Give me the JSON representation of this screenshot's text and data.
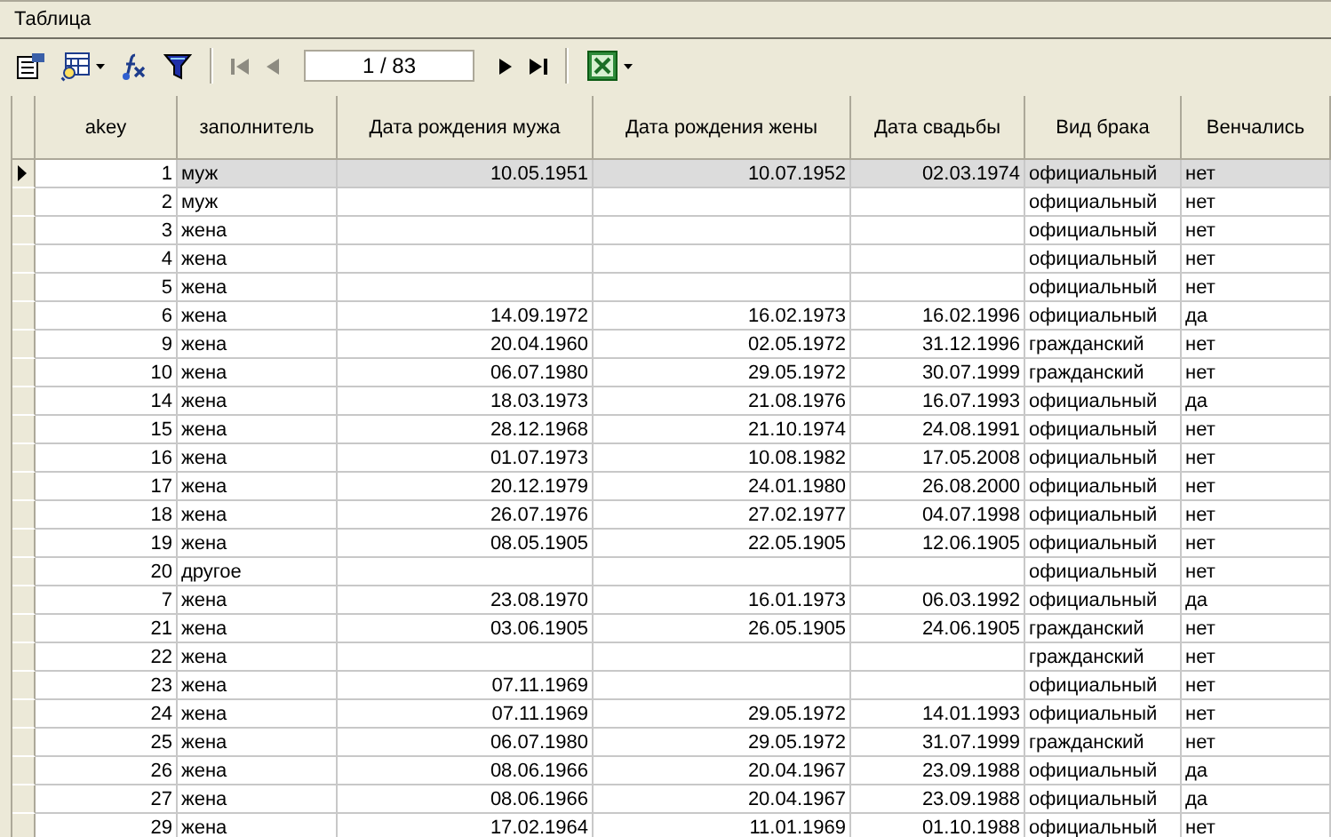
{
  "window": {
    "title": "Таблица"
  },
  "toolbar": [
    {
      "kind": "properties",
      "disabled": false,
      "dropdown": false
    },
    {
      "kind": "grid-search",
      "disabled": false,
      "dropdown": true
    },
    {
      "kind": "formula",
      "disabled": false,
      "dropdown": false
    },
    {
      "kind": "filter",
      "disabled": false,
      "dropdown": false
    },
    {
      "kind": "separator"
    },
    {
      "kind": "first",
      "disabled": true,
      "dropdown": false
    },
    {
      "kind": "prev",
      "disabled": true,
      "dropdown": false
    },
    {
      "kind": "page",
      "value": "1 / 83"
    },
    {
      "kind": "next",
      "disabled": false,
      "dropdown": false
    },
    {
      "kind": "last",
      "disabled": false,
      "dropdown": false
    },
    {
      "kind": "separator"
    },
    {
      "kind": "excel",
      "disabled": false,
      "dropdown": true
    }
  ],
  "table": {
    "columns": [
      "akey",
      "заполнитель",
      "Дата рождения мужа",
      "Дата рождения жены",
      "Дата свадьбы",
      "Вид брака",
      "Венчались"
    ],
    "rows": [
      {
        "selected": true,
        "cells": [
          "1",
          "муж",
          "10.05.1951",
          "10.07.1952",
          "02.03.1974",
          "официальный",
          "нет"
        ]
      },
      {
        "selected": false,
        "cells": [
          "2",
          "муж",
          null,
          null,
          null,
          "официальный",
          "нет"
        ]
      },
      {
        "selected": false,
        "cells": [
          "3",
          "жена",
          null,
          null,
          null,
          "официальный",
          "нет"
        ]
      },
      {
        "selected": false,
        "cells": [
          "4",
          "жена",
          null,
          null,
          null,
          "официальный",
          "нет"
        ]
      },
      {
        "selected": false,
        "cells": [
          "5",
          "жена",
          null,
          null,
          null,
          "официальный",
          "нет"
        ]
      },
      {
        "selected": false,
        "cells": [
          "6",
          "жена",
          "14.09.1972",
          "16.02.1973",
          "16.02.1996",
          "официальный",
          "да"
        ]
      },
      {
        "selected": false,
        "cells": [
          "9",
          "жена",
          "20.04.1960",
          "02.05.1972",
          "31.12.1996",
          "гражданский",
          "нет"
        ]
      },
      {
        "selected": false,
        "cells": [
          "10",
          "жена",
          "06.07.1980",
          "29.05.1972",
          "30.07.1999",
          "гражданский",
          "нет"
        ]
      },
      {
        "selected": false,
        "cells": [
          "14",
          "жена",
          "18.03.1973",
          "21.08.1976",
          "16.07.1993",
          "официальный",
          "да"
        ]
      },
      {
        "selected": false,
        "cells": [
          "15",
          "жена",
          "28.12.1968",
          "21.10.1974",
          "24.08.1991",
          "официальный",
          "нет"
        ]
      },
      {
        "selected": false,
        "cells": [
          "16",
          "жена",
          "01.07.1973",
          "10.08.1982",
          "17.05.2008",
          "официальный",
          "нет"
        ]
      },
      {
        "selected": false,
        "cells": [
          "17",
          "жена",
          "20.12.1979",
          "24.01.1980",
          "26.08.2000",
          "официальный",
          "нет"
        ]
      },
      {
        "selected": false,
        "cells": [
          "18",
          "жена",
          "26.07.1976",
          "27.02.1977",
          "04.07.1998",
          "официальный",
          "нет"
        ]
      },
      {
        "selected": false,
        "cells": [
          "19",
          "жена",
          "08.05.1905",
          "22.05.1905",
          "12.06.1905",
          "официальный",
          "нет"
        ]
      },
      {
        "selected": false,
        "cells": [
          "20",
          "другое",
          null,
          null,
          null,
          "официальный",
          "нет"
        ]
      },
      {
        "selected": false,
        "cells": [
          "7",
          "жена",
          "23.08.1970",
          "16.01.1973",
          "06.03.1992",
          "официальный",
          "да"
        ]
      },
      {
        "selected": false,
        "cells": [
          "21",
          "жена",
          "03.06.1905",
          "26.05.1905",
          "24.06.1905",
          "гражданский",
          "нет"
        ]
      },
      {
        "selected": false,
        "cells": [
          "22",
          "жена",
          null,
          null,
          null,
          "гражданский",
          "нет"
        ]
      },
      {
        "selected": false,
        "cells": [
          "23",
          "жена",
          "07.11.1969",
          null,
          null,
          "официальный",
          "нет"
        ]
      },
      {
        "selected": false,
        "cells": [
          "24",
          "жена",
          "07.11.1969",
          "29.05.1972",
          "14.01.1993",
          "официальный",
          "нет"
        ]
      },
      {
        "selected": false,
        "cells": [
          "25",
          "жена",
          "06.07.1980",
          "29.05.1972",
          "31.07.1999",
          "гражданский",
          "нет"
        ]
      },
      {
        "selected": false,
        "cells": [
          "26",
          "жена",
          "08.06.1966",
          "20.04.1967",
          "23.09.1988",
          "официальный",
          "да"
        ]
      },
      {
        "selected": false,
        "cells": [
          "27",
          "жена",
          "08.06.1966",
          "20.04.1967",
          "23.09.1988",
          "официальный",
          "да"
        ]
      },
      {
        "selected": false,
        "cells": [
          "29",
          "жена",
          "17.02.1964",
          "11.01.1969",
          "01.10.1988",
          "официальный",
          "нет"
        ]
      }
    ]
  }
}
